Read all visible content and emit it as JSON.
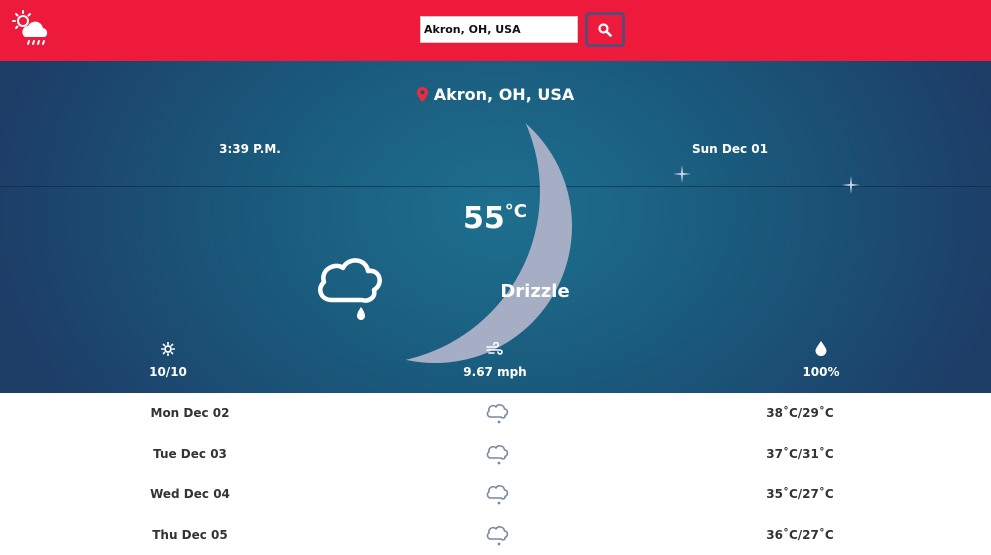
{
  "header": {
    "logo_icon": "weather-logo-icon",
    "search": {
      "value": "Akron, OH, USA",
      "placeholder": ""
    },
    "search_button_icon": "search-icon"
  },
  "current": {
    "location": "Akron, OH, USA",
    "time": "3:39 P.M.",
    "date": "Sun Dec 01",
    "temperature": "55",
    "temperature_unit": "°C",
    "condition": "Drizzle",
    "condition_icon": "cloud-drizzle-icon",
    "stats": [
      {
        "icon": "sun-icon",
        "value": "10/10"
      },
      {
        "icon": "wind-icon",
        "value": "9.67 mph"
      },
      {
        "icon": "humidity-drop-icon",
        "value": "100%"
      }
    ]
  },
  "forecast": [
    {
      "day": "Mon Dec 02",
      "icon": "cloud-drizzle-icon",
      "range": "38˚C/29˚C"
    },
    {
      "day": "Tue Dec 03",
      "icon": "cloud-drizzle-icon",
      "range": "37˚C/31˚C"
    },
    {
      "day": "Wed Dec 04",
      "icon": "cloud-drizzle-icon",
      "range": "35˚C/27˚C"
    },
    {
      "day": "Thu Dec 05",
      "icon": "cloud-drizzle-icon",
      "range": "36˚C/27˚C"
    }
  ],
  "colors": {
    "header": "#ee1a3c",
    "hero_dark": "#1d3c66",
    "hero_light": "#1e6f8f",
    "moon": "#a5aec4"
  }
}
